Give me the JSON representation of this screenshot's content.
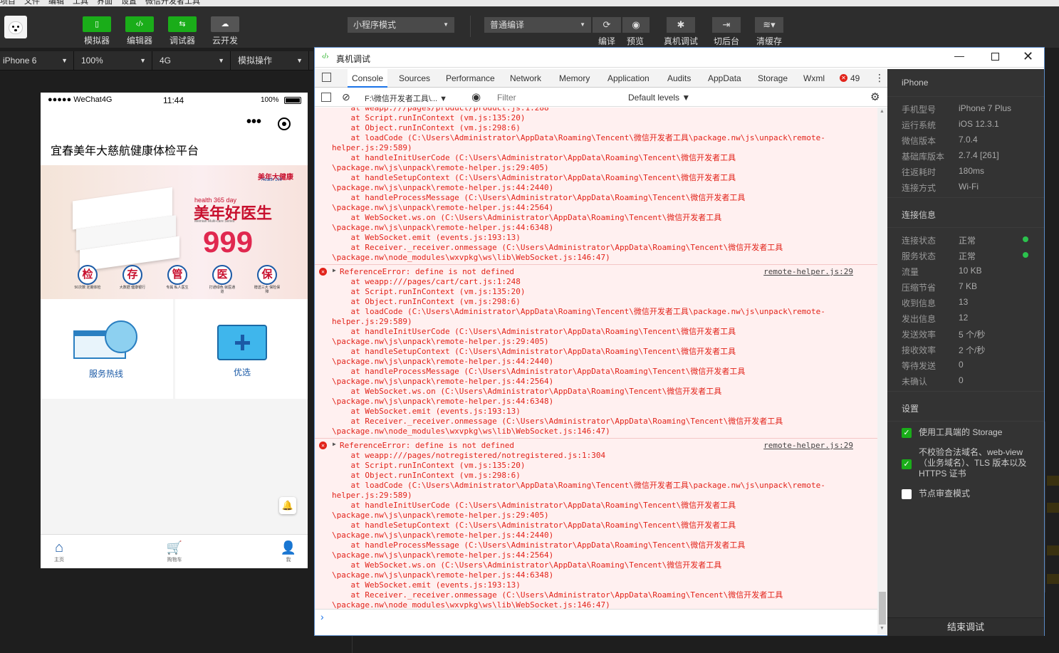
{
  "menubar": {
    "items": [
      "项目",
      "文件",
      "编辑",
      "工具",
      "界面",
      "设置",
      "微信开发者工具"
    ]
  },
  "toolbar": {
    "buttons": [
      {
        "label": "模拟器",
        "icon": "phone-icon",
        "active": true
      },
      {
        "label": "编辑器",
        "icon": "code-icon",
        "active": true
      },
      {
        "label": "调试器",
        "icon": "debug-icon",
        "active": true
      },
      {
        "label": "云开发",
        "icon": "cloud-icon",
        "active": false
      }
    ],
    "mode_select": "小程序模式",
    "compile_select": "普通编译",
    "compile_label": "编译",
    "preview_label": "预览",
    "remote_debug_label": "真机调试",
    "background_label": "切后台",
    "clear_cache_label": "清缓存"
  },
  "device_bar": {
    "device": "iPhone 6",
    "zoom": "100%",
    "network": "4G",
    "operation": "模拟操作"
  },
  "simulator": {
    "status": {
      "carrier": "●●●●● WeChat4G",
      "time": "11:44",
      "battery": "100%"
    },
    "nav_title": "宜春美年大慈航健康体检平台",
    "banner": {
      "brand": "美年大健康",
      "brand_en": "Health 100",
      "tagline": "health 365 day",
      "title": "美年好医生",
      "subtitle": "Meinian Multi-care Series",
      "price": "999",
      "badges": [
        {
          "char": "检",
          "sub": "50次数 定期体检"
        },
        {
          "char": "存",
          "sub": "大数据 健康银行"
        },
        {
          "char": "管",
          "sub": "专属 私人医生"
        },
        {
          "char": "医",
          "sub": "打通绿色 就医通道"
        },
        {
          "char": "保",
          "sub": "赠送三大 保险保障"
        }
      ]
    },
    "grid": [
      {
        "label": "服务热线"
      },
      {
        "label": "优选"
      }
    ],
    "tabs": [
      {
        "label": "主页"
      },
      {
        "label": "购物车"
      },
      {
        "label": "我"
      }
    ]
  },
  "devtools": {
    "title": "真机调试",
    "tabs": [
      "Console",
      "Sources",
      "Performance",
      "Network",
      "Memory",
      "Application",
      "Audits",
      "AppData",
      "Storage",
      "Wxml"
    ],
    "error_count": "49",
    "context": "F:\\微信开发者工具\\...",
    "filter_placeholder": "Filter",
    "levels": "Default levels ▼",
    "console_lines_top": [
      "    at weapp:///pages/product/product.js:1:288",
      "    at Script.runInContext (vm.js:135:20)",
      "    at Object.runInContext (vm.js:298:6)",
      "    at loadCode (C:\\Users\\Administrator\\AppData\\Roaming\\Tencent\\微信开发者工具\\package.nw\\js\\unpack\\remote-",
      "helper.js:29:589)",
      "    at handleInitUserCode (C:\\Users\\Administrator\\AppData\\Roaming\\Tencent\\微信开发者工具",
      "\\package.nw\\js\\unpack\\remote-helper.js:29:405)",
      "    at handleSetupContext (C:\\Users\\Administrator\\AppData\\Roaming\\Tencent\\微信开发者工具",
      "\\package.nw\\js\\unpack\\remote-helper.js:44:2440)",
      "    at handleProcessMessage (C:\\Users\\Administrator\\AppData\\Roaming\\Tencent\\微信开发者工具",
      "\\package.nw\\js\\unpack\\remote-helper.js:44:2564)",
      "    at WebSocket.ws.on (C:\\Users\\Administrator\\AppData\\Roaming\\Tencent\\微信开发者工具",
      "\\package.nw\\js\\unpack\\remote-helper.js:44:6348)",
      "    at WebSocket.emit (events.js:193:13)",
      "    at Receiver._receiver.onmessage (C:\\Users\\Administrator\\AppData\\Roaming\\Tencent\\微信开发者工具",
      "\\package.nw\\node_modules\\wxvpkg\\ws\\lib\\WebSocket.js:146:47)"
    ],
    "errors": [
      {
        "message": "ReferenceError: define is not defined",
        "source": "remote-helper.js:29",
        "lines": [
          "    at weapp:///pages/cart/cart.js:1:248",
          "    at Script.runInContext (vm.js:135:20)",
          "    at Object.runInContext (vm.js:298:6)",
          "    at loadCode (C:\\Users\\Administrator\\AppData\\Roaming\\Tencent\\微信开发者工具\\package.nw\\js\\unpack\\remote-",
          "helper.js:29:589)",
          "    at handleInitUserCode (C:\\Users\\Administrator\\AppData\\Roaming\\Tencent\\微信开发者工具",
          "\\package.nw\\js\\unpack\\remote-helper.js:29:405)",
          "    at handleSetupContext (C:\\Users\\Administrator\\AppData\\Roaming\\Tencent\\微信开发者工具",
          "\\package.nw\\js\\unpack\\remote-helper.js:44:2440)",
          "    at handleProcessMessage (C:\\Users\\Administrator\\AppData\\Roaming\\Tencent\\微信开发者工具",
          "\\package.nw\\js\\unpack\\remote-helper.js:44:2564)",
          "    at WebSocket.ws.on (C:\\Users\\Administrator\\AppData\\Roaming\\Tencent\\微信开发者工具",
          "\\package.nw\\js\\unpack\\remote-helper.js:44:6348)",
          "    at WebSocket.emit (events.js:193:13)",
          "    at Receiver._receiver.onmessage (C:\\Users\\Administrator\\AppData\\Roaming\\Tencent\\微信开发者工具",
          "\\package.nw\\node_modules\\wxvpkg\\ws\\lib\\WebSocket.js:146:47)"
        ]
      },
      {
        "message": "ReferenceError: define is not defined",
        "source": "remote-helper.js:29",
        "lines": [
          "    at weapp:///pages/notregistered/notregistered.js:1:304",
          "    at Script.runInContext (vm.js:135:20)",
          "    at Object.runInContext (vm.js:298:6)",
          "    at loadCode (C:\\Users\\Administrator\\AppData\\Roaming\\Tencent\\微信开发者工具\\package.nw\\js\\unpack\\remote-",
          "helper.js:29:589)",
          "    at handleInitUserCode (C:\\Users\\Administrator\\AppData\\Roaming\\Tencent\\微信开发者工具",
          "\\package.nw\\js\\unpack\\remote-helper.js:29:405)",
          "    at handleSetupContext (C:\\Users\\Administrator\\AppData\\Roaming\\Tencent\\微信开发者工具",
          "\\package.nw\\js\\unpack\\remote-helper.js:44:2440)",
          "    at handleProcessMessage (C:\\Users\\Administrator\\AppData\\Roaming\\Tencent\\微信开发者工具",
          "\\package.nw\\js\\unpack\\remote-helper.js:44:2564)",
          "    at WebSocket.ws.on (C:\\Users\\Administrator\\AppData\\Roaming\\Tencent\\微信开发者工具",
          "\\package.nw\\js\\unpack\\remote-helper.js:44:6348)",
          "    at WebSocket.emit (events.js:193:13)",
          "    at Receiver._receiver.onmessage (C:\\Users\\Administrator\\AppData\\Roaming\\Tencent\\微信开发者工具",
          "\\package.nw\\node_modules\\wxvpkg\\ws\\lib\\WebSocket.js:146:47)"
        ]
      }
    ],
    "prompt": "›"
  },
  "remote_panel": {
    "device_header": "iPhone",
    "device_info": [
      {
        "label": "手机型号",
        "value": "iPhone 7 Plus"
      },
      {
        "label": "运行系统",
        "value": "iOS 12.3.1"
      },
      {
        "label": "微信版本",
        "value": "7.0.4"
      },
      {
        "label": "基础库版本",
        "value": "2.7.4 [261]"
      },
      {
        "label": "往返耗时",
        "value": "180ms"
      },
      {
        "label": "连接方式",
        "value": "Wi-Fi"
      }
    ],
    "conn_header": "连接信息",
    "conn_info": [
      {
        "label": "连接状态",
        "value": "正常",
        "dot": true
      },
      {
        "label": "服务状态",
        "value": "正常",
        "dot": true
      },
      {
        "label": "流量",
        "value": "10 KB"
      },
      {
        "label": "压缩节省",
        "value": "7 KB"
      },
      {
        "label": "收到信息",
        "value": "13"
      },
      {
        "label": "发出信息",
        "value": "12"
      },
      {
        "label": "发送效率",
        "value": "5 个/秒"
      },
      {
        "label": "接收效率",
        "value": "2 个/秒"
      },
      {
        "label": "等待发送",
        "value": "0"
      },
      {
        "label": "未确认",
        "value": "0"
      }
    ],
    "settings_header": "设置",
    "settings": [
      {
        "label": "使用工具端的 Storage",
        "checked": true
      },
      {
        "label": "不校验合法域名、web-view（业务域名）、TLS 版本以及 HTTPS 证书",
        "checked": true
      },
      {
        "label": "节点审查模式",
        "checked": false
      }
    ],
    "end_button": "结束调试"
  }
}
